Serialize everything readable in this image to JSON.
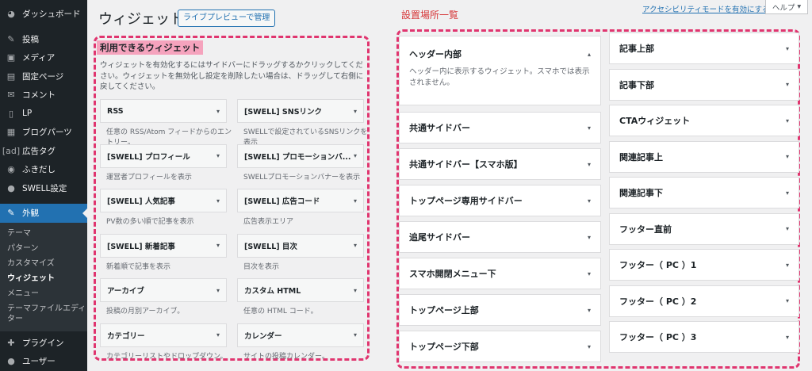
{
  "sidebar": {
    "top": [
      {
        "icon": "dashboard-icon",
        "glyph": "◕",
        "label": "ダッシュボード"
      }
    ],
    "items": [
      {
        "icon": "pin-icon",
        "glyph": "✎",
        "label": "投稿"
      },
      {
        "icon": "media-icon",
        "glyph": "▣",
        "label": "メディア"
      },
      {
        "icon": "page-icon",
        "glyph": "▤",
        "label": "固定ページ"
      },
      {
        "icon": "comment-icon",
        "glyph": "✉",
        "label": "コメント"
      },
      {
        "icon": "lp-icon",
        "glyph": "▯",
        "label": "LP"
      },
      {
        "icon": "blog-parts-icon",
        "glyph": "▦",
        "label": "ブログパーツ"
      },
      {
        "icon": "ad-tag-icon",
        "glyph": "[ad]",
        "label": "広告タグ"
      },
      {
        "icon": "speech-bubble-icon",
        "glyph": "◉",
        "label": "ふきだし"
      },
      {
        "icon": "swell-settings-icon",
        "glyph": "●",
        "label": "SWELL設定"
      }
    ],
    "active": {
      "icon": "appearance-icon",
      "glyph": "✎",
      "label": "外観"
    },
    "submenu": [
      "テーマ",
      "パターン",
      "カスタマイズ",
      "ウィジェット",
      "メニュー",
      "テーマファイルエディター"
    ],
    "submenu_current": "ウィジェット",
    "bottom": [
      {
        "icon": "plugin-icon",
        "glyph": "✚",
        "label": "プラグイン"
      },
      {
        "icon": "user-icon",
        "glyph": "●",
        "label": "ユーザー"
      }
    ]
  },
  "header": {
    "title": "ウィジェット",
    "live_preview_button": "ライブプレビューで管理",
    "accessibility_link": "アクセシビリティモードを有効にする",
    "help_button": "ヘルプ",
    "help_caret": "▾",
    "placements_title": "設置場所一覧"
  },
  "available": {
    "title": "利用できるウィジェット",
    "description": "ウィジェットを有効化するにはサイドバーにドラッグするかクリックしてください。ウィジェットを無効化し設定を削除したい場合は、ドラッグして右側に戻してください。",
    "caret": "▾",
    "widgets": [
      {
        "name": "RSS",
        "desc": "任意の RSS/Atom フィードからのエントリー。"
      },
      {
        "name": "[SWELL] SNSリンク",
        "desc": "SWELLで設定されているSNSリンクを表示"
      },
      {
        "name": "[SWELL] プロフィール",
        "desc": "運営者プロフィールを表示"
      },
      {
        "name": "[SWELL] プロモーションバ...",
        "desc": "SWELLプロモーションバナーを表示"
      },
      {
        "name": "[SWELL] 人気記事",
        "desc": "PV数の多い順で記事を表示"
      },
      {
        "name": "[SWELL] 広告コード",
        "desc": "広告表示エリア"
      },
      {
        "name": "[SWELL] 新着記事",
        "desc": "新着順で記事を表示"
      },
      {
        "name": "[SWELL] 目次",
        "desc": "目次を表示"
      },
      {
        "name": "アーカイブ",
        "desc": "投稿の月別アーカイブ。"
      },
      {
        "name": "カスタム HTML",
        "desc": "任意の HTML コード。"
      },
      {
        "name": "カテゴリー",
        "desc": "カテゴリーリストやドロップダウン。"
      },
      {
        "name": "カレンダー",
        "desc": "サイトの投稿カレンダー。"
      }
    ]
  },
  "areas": {
    "caret": "▾",
    "open_caret": "▴",
    "left": [
      {
        "name": "ヘッダー内部",
        "desc": "ヘッダー内に表示するウィジェット。スマホでは表示されません。",
        "open": true
      },
      {
        "name": "共通サイドバー"
      },
      {
        "name": "共通サイドバー【スマホ版】"
      },
      {
        "name": "トップページ専用サイドバー"
      },
      {
        "name": "追尾サイドバー"
      },
      {
        "name": "スマホ開閉メニュー下"
      },
      {
        "name": "トップページ上部"
      },
      {
        "name": "トップページ下部"
      }
    ],
    "right": [
      {
        "name": "記事上部"
      },
      {
        "name": "記事下部"
      },
      {
        "name": "CTAウィジェット"
      },
      {
        "name": "関連記事上"
      },
      {
        "name": "関連記事下"
      },
      {
        "name": "フッター直前"
      },
      {
        "name": "フッター（ PC ）1"
      },
      {
        "name": "フッター（ PC ）2"
      },
      {
        "name": "フッター（ PC ）3"
      }
    ]
  }
}
